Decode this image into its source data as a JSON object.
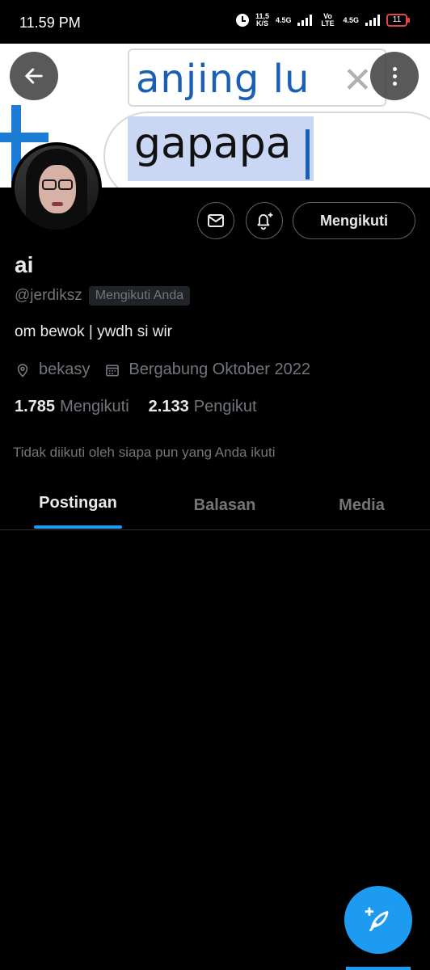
{
  "status_bar": {
    "time": "11.59 PM",
    "net_speed_value": "11,5",
    "net_speed_unit": "K/S",
    "sim1_label": "4.5G",
    "volte_label": "Vo LTE",
    "sim2_label": "4.5G",
    "battery_level": "11",
    "battery_color": "#e0454a"
  },
  "banner": {
    "line1": "anjing lu",
    "line2": "gapapa"
  },
  "profile": {
    "display_name": "ai",
    "handle": "@jerdiksz",
    "follows_you_badge": "Mengikuti Anda",
    "bio": "om bewok | ywdh si wir",
    "location": "bekasy",
    "joined": "Bergabung Oktober 2022",
    "following_count": "1.785",
    "following_label": "Mengikuti",
    "followers_count": "2.133",
    "followers_label": "Pengikut",
    "mutual_note": "Tidak diikuti oleh siapa pun yang Anda ikuti"
  },
  "actions": {
    "follow_label": "Mengikuti"
  },
  "tabs": [
    {
      "label": "Postingan",
      "active": true
    },
    {
      "label": "Balasan",
      "active": false
    },
    {
      "label": "Media",
      "active": false
    }
  ],
  "icons": {
    "back": "arrow-left-icon",
    "more": "more-vertical-icon",
    "message": "envelope-icon",
    "notify": "bell-plus-icon",
    "location": "location-pin-icon",
    "calendar": "calendar-icon",
    "compose": "compose-feather-icon"
  },
  "colors": {
    "accent": "#1d9bf0",
    "background": "#000000",
    "secondary_text": "#71767b"
  }
}
